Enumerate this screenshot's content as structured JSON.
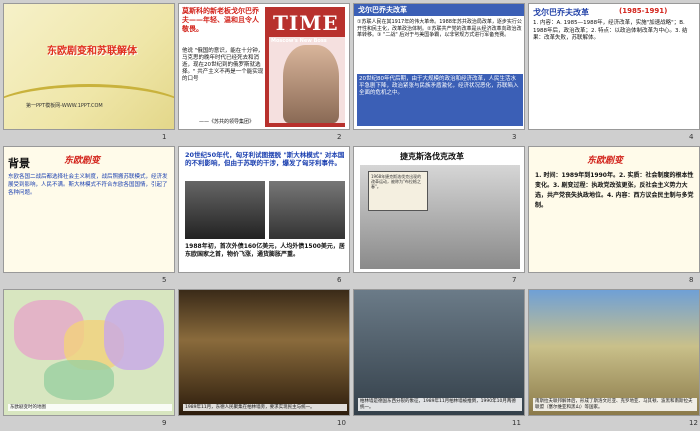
{
  "slides": [
    {
      "num": "1",
      "title": "东欧剧变和苏联解体",
      "subtitle": "第一PPT模板网-WWW.1PPT.COM"
    },
    {
      "num": "2",
      "heading": "莫斯科的新老板戈尔巴乔夫——年轻、温和且令人敬畏。",
      "body": "他说 \"俄国的意识，能在十分钟，马克思的晚年时代已经死去和消逝，现在20世纪到的俄罗斯就选择。\" 共产主义不再是一个能实现的口号",
      "source": "——《苏共的领导集团》",
      "magazine": "TIME",
      "cover_caption": "Moscow's New Boss"
    },
    {
      "num": "3",
      "heading": "戈尔巴乔夫改革",
      "body": "①苏联人民在其1917年的伟大革命。1988年苏共政治局改革，逐步实行公开性和民主化，改革政治体制。②苏联共产党的改革是从经济改革向政治改革转移。③ \"二战\" 后对于与美国争霸，以非常规方式进行军备竞赛。",
      "box": "20世纪80年代后期，由于大规模的政治和经济改革，人民生活水平急剧下降，政治紧张与民族矛盾激化，经济状况恶化，苏联陷入全面的危机之中。"
    },
    {
      "num": "4",
      "heading": "戈尔巴乔夫改革",
      "years": "(1985-1991)",
      "body": "1. 内容：A. 1985—1988年，经济改革，实施\"加速战略\"；B. 1988年后，政治改革；2. 特点：以政治体制改革为中心。3. 结果：改革失败，苏联解体。"
    },
    {
      "num": "5",
      "label": "背景",
      "tag": "东欧剧变",
      "body": "东欧各国二战后都选择社会主义制度，战后照搬苏联模式，经济发展受到影响，人民不满。斯大林模式不符合东欧各国国情，引起了各种问题。"
    },
    {
      "num": "6",
      "heading": "20世纪50年代，匈牙利试图摆脱 \"斯大林模式\" 对本国的不利影响，但由于苏联的干涉，爆发了匈牙利事件。",
      "foot": "1988年初，首次外债160亿美元，人均外债1500美元，居东欧国家之首，物价飞涨，通货膨胀严重。"
    },
    {
      "num": "7",
      "heading": "捷克斯洛伐克改革",
      "card": "1968年捷克斯洛伐克出现的改革运动，被称为\"布拉格之春\"。"
    },
    {
      "num": "8",
      "tag": "东欧剧变",
      "body": "1. 时间：1989年到1990年。2. 实质：社会制度的根本性变化。3. 剧变过程：执政党改弦更张，反社会主义势力大选，共产党丧失执政地位。4. 内容：西方议会民主制与多党制。"
    },
    {
      "num": "9",
      "caption": "东欧剧变时的地图"
    },
    {
      "num": "10",
      "caption": "1989年11月，东德人民聚集在柏林墙旁，要求实现民主与统一。"
    },
    {
      "num": "11",
      "caption": "柏林墙是德国东西分裂的象征，1989年11月柏林墙被推倒，1990年10月两德统一。"
    },
    {
      "num": "12",
      "caption": "南斯拉夫联邦解体后，形成了斯洛文尼亚、克罗地亚、马其顿、波黑和南斯拉夫联盟（塞尔维亚和黑山）等国家。"
    }
  ],
  "colors": {
    "accent_red": "#d2221a",
    "accent_blue": "#1a3fb0",
    "time_red": "#b8312d"
  }
}
